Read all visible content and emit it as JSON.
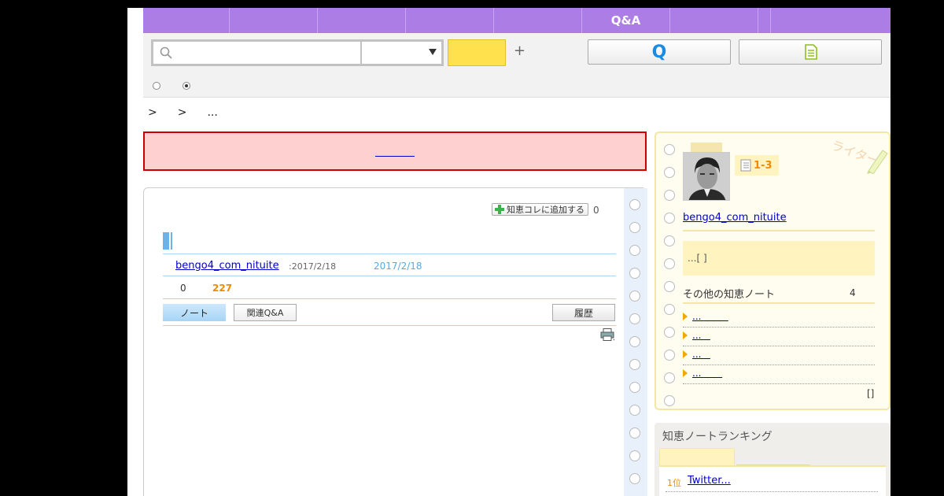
{
  "nav": {
    "tabs": [
      "",
      "",
      "",
      "",
      "",
      "Q&A",
      "",
      ""
    ]
  },
  "search": {
    "value": "",
    "placeholder": "",
    "category": "",
    "button_label": "",
    "question_button_label": "Q"
  },
  "breadcrumb": [
    ">",
    ">",
    "..."
  ],
  "alert": {
    "link_text": ""
  },
  "note": {
    "add_button_label": "知恵コレに追加する",
    "add_count": "0",
    "author": "bengo4_com_nituite",
    "created": ":2017/2/18",
    "updated": "2017/2/18",
    "stat_zero": "0",
    "views": "227",
    "tabs": {
      "note": "ノート",
      "related": "関連Q&A",
      "history": "履歴"
    }
  },
  "profile": {
    "level": "1-3",
    "stamp": "ライター",
    "name": "bengo4_com_nituite",
    "intro": "...[      ]",
    "other_notes_title": "その他の知恵ノート",
    "other_notes_count": "4",
    "other_notes": [
      "...         ",
      "...   ",
      "...   ",
      "...       "
    ],
    "more": "[]"
  },
  "ranking": {
    "title": "知恵ノートランキング",
    "items": [
      {
        "rank": "1位",
        "title": "Twitter...  "
      }
    ]
  },
  "colors": {
    "nav_purple": "#ad7de6",
    "search_yellow": "#ffe14d",
    "alert_bg": "#ffd0d0",
    "alert_border": "#cc0000",
    "accent_orange": "#f08a00",
    "link_blue": "#0000cc"
  }
}
